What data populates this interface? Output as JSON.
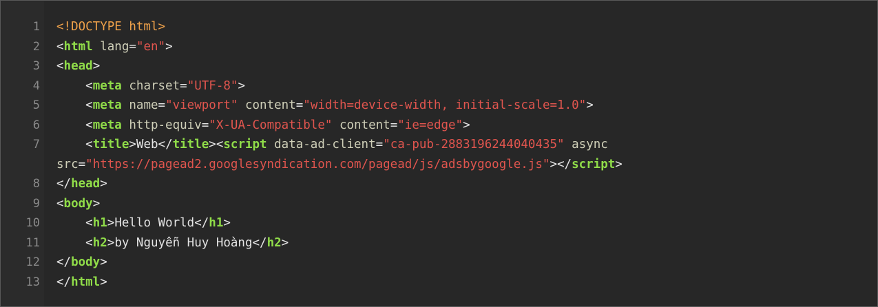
{
  "code": {
    "lines": [
      {
        "num": "1",
        "rows": [
          [
            {
              "t": "<!DOCTYPE html>",
              "k": "doc"
            }
          ]
        ]
      },
      {
        "num": "2",
        "rows": [
          [
            {
              "t": "<",
              "k": "br"
            },
            {
              "t": "html",
              "k": "tag"
            },
            {
              "t": " lang",
              "k": "attr"
            },
            {
              "t": "=",
              "k": "br"
            },
            {
              "t": "\"en\"",
              "k": "str"
            },
            {
              "t": ">",
              "k": "br"
            }
          ]
        ]
      },
      {
        "num": "3",
        "rows": [
          [
            {
              "t": "<",
              "k": "br"
            },
            {
              "t": "head",
              "k": "tag"
            },
            {
              "t": ">",
              "k": "br"
            }
          ]
        ]
      },
      {
        "num": "4",
        "rows": [
          [
            {
              "t": "    <",
              "k": "br"
            },
            {
              "t": "meta",
              "k": "tag"
            },
            {
              "t": " charset",
              "k": "attr"
            },
            {
              "t": "=",
              "k": "br"
            },
            {
              "t": "\"UTF-8\"",
              "k": "str"
            },
            {
              "t": ">",
              "k": "br"
            }
          ]
        ]
      },
      {
        "num": "5",
        "rows": [
          [
            {
              "t": "    <",
              "k": "br"
            },
            {
              "t": "meta",
              "k": "tag"
            },
            {
              "t": " name",
              "k": "attr"
            },
            {
              "t": "=",
              "k": "br"
            },
            {
              "t": "\"viewport\"",
              "k": "str"
            },
            {
              "t": " content",
              "k": "attr"
            },
            {
              "t": "=",
              "k": "br"
            },
            {
              "t": "\"width=device-width, initial-scale=1.0\"",
              "k": "str"
            },
            {
              "t": ">",
              "k": "br"
            }
          ]
        ]
      },
      {
        "num": "6",
        "rows": [
          [
            {
              "t": "    <",
              "k": "br"
            },
            {
              "t": "meta",
              "k": "tag"
            },
            {
              "t": " http-equiv",
              "k": "attr"
            },
            {
              "t": "=",
              "k": "br"
            },
            {
              "t": "\"X-UA-Compatible\"",
              "k": "str"
            },
            {
              "t": " content",
              "k": "attr"
            },
            {
              "t": "=",
              "k": "br"
            },
            {
              "t": "\"ie=edge\"",
              "k": "str"
            },
            {
              "t": ">",
              "k": "br"
            }
          ]
        ]
      },
      {
        "num": "7",
        "rows": [
          [
            {
              "t": "    <",
              "k": "br"
            },
            {
              "t": "title",
              "k": "tag"
            },
            {
              "t": ">",
              "k": "br"
            },
            {
              "t": "Web",
              "k": "text"
            },
            {
              "t": "</",
              "k": "br"
            },
            {
              "t": "title",
              "k": "tag"
            },
            {
              "t": "><",
              "k": "br"
            },
            {
              "t": "script",
              "k": "tag"
            },
            {
              "t": " data-ad-client",
              "k": "attr"
            },
            {
              "t": "=",
              "k": "br"
            },
            {
              "t": "\"ca-pub-2883196244040435\"",
              "k": "str"
            },
            {
              "t": " async",
              "k": "attr"
            }
          ],
          [
            {
              "t": "src",
              "k": "attr"
            },
            {
              "t": "=",
              "k": "br"
            },
            {
              "t": "\"https://pagead2.googlesyndication.com/pagead/js/adsbygoogle.js\"",
              "k": "str"
            },
            {
              "t": "></",
              "k": "br"
            },
            {
              "t": "script",
              "k": "tag"
            },
            {
              "t": ">",
              "k": "br"
            }
          ]
        ]
      },
      {
        "num": "8",
        "rows": [
          [
            {
              "t": "</",
              "k": "br"
            },
            {
              "t": "head",
              "k": "tag"
            },
            {
              "t": ">",
              "k": "br"
            }
          ]
        ]
      },
      {
        "num": "9",
        "rows": [
          [
            {
              "t": "<",
              "k": "br"
            },
            {
              "t": "body",
              "k": "tag"
            },
            {
              "t": ">",
              "k": "br"
            }
          ]
        ]
      },
      {
        "num": "10",
        "rows": [
          [
            {
              "t": "    <",
              "k": "br"
            },
            {
              "t": "h1",
              "k": "tag"
            },
            {
              "t": ">",
              "k": "br"
            },
            {
              "t": "Hello World",
              "k": "text"
            },
            {
              "t": "</",
              "k": "br"
            },
            {
              "t": "h1",
              "k": "tag"
            },
            {
              "t": ">",
              "k": "br"
            }
          ]
        ]
      },
      {
        "num": "11",
        "rows": [
          [
            {
              "t": "    <",
              "k": "br"
            },
            {
              "t": "h2",
              "k": "tag"
            },
            {
              "t": ">",
              "k": "br"
            },
            {
              "t": "by Nguyễn Huy Hoàng",
              "k": "text"
            },
            {
              "t": "</",
              "k": "br"
            },
            {
              "t": "h2",
              "k": "tag"
            },
            {
              "t": ">",
              "k": "br"
            }
          ]
        ]
      },
      {
        "num": "12",
        "rows": [
          [
            {
              "t": "</",
              "k": "br"
            },
            {
              "t": "body",
              "k": "tag"
            },
            {
              "t": ">",
              "k": "br"
            }
          ]
        ]
      },
      {
        "num": "13",
        "rows": [
          [
            {
              "t": "</",
              "k": "br"
            },
            {
              "t": "html",
              "k": "tag"
            },
            {
              "t": ">",
              "k": "br"
            }
          ]
        ]
      }
    ]
  }
}
